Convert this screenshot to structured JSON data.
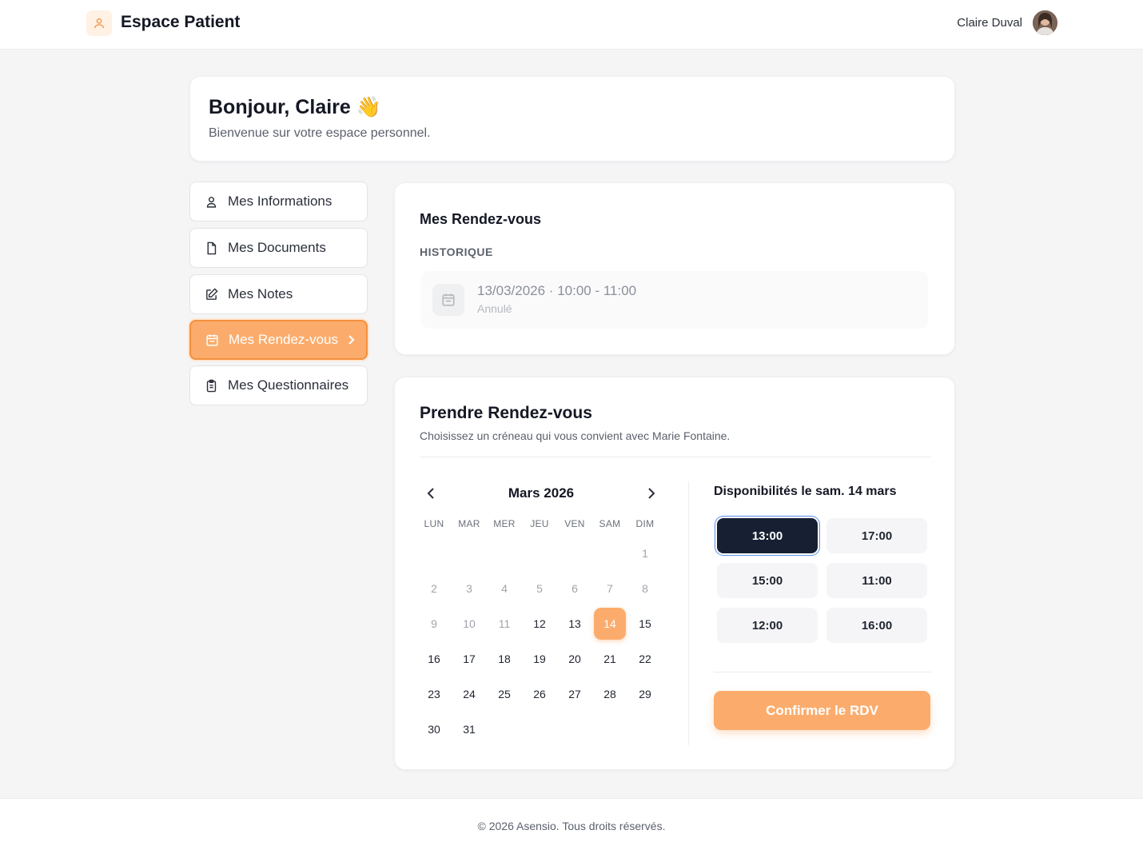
{
  "header": {
    "brand_title": "Espace Patient",
    "user_name": "Claire Duval"
  },
  "welcome": {
    "title": "Bonjour, Claire 👋",
    "subtitle": "Bienvenue sur votre espace personnel."
  },
  "sidebar": {
    "items": [
      {
        "label": "Mes Informations",
        "icon": "user-icon",
        "active": false
      },
      {
        "label": "Mes Documents",
        "icon": "document-icon",
        "active": false
      },
      {
        "label": "Mes Notes",
        "icon": "edit-icon",
        "active": false
      },
      {
        "label": "Mes Rendez-vous",
        "icon": "calendar-icon",
        "active": true
      },
      {
        "label": "Mes Questionnaires",
        "icon": "clipboard-icon",
        "active": false
      }
    ]
  },
  "appointments": {
    "title": "Mes Rendez-vous",
    "history_label": "HISTORIQUE",
    "history": [
      {
        "datetime": "13/03/2026 · 10:00 - 11:00",
        "status": "Annulé"
      }
    ]
  },
  "booking": {
    "title": "Prendre Rendez-vous",
    "subtitle": "Choisissez un créneau qui vous convient avec Marie Fontaine.",
    "calendar": {
      "month_label": "Mars 2026",
      "weekdays": [
        "LUN",
        "MAR",
        "MER",
        "JEU",
        "VEN",
        "SAM",
        "DIM"
      ],
      "first_weekday_index": 6,
      "days_in_month": 31,
      "past_until": 11,
      "selected_day": 14
    },
    "slots_title": "Disponibilités le sam. 14 mars",
    "slots": [
      "13:00",
      "17:00",
      "15:00",
      "11:00",
      "12:00",
      "16:00"
    ],
    "selected_slot": "13:00",
    "confirm_label": "Confirmer le RDV"
  },
  "footer": {
    "text": "© 2026 Asensio. Tous droits réservés."
  },
  "colors": {
    "accent": "#fbac6c",
    "accent_border": "#f3903e",
    "selected_slot_bg": "#172033"
  }
}
